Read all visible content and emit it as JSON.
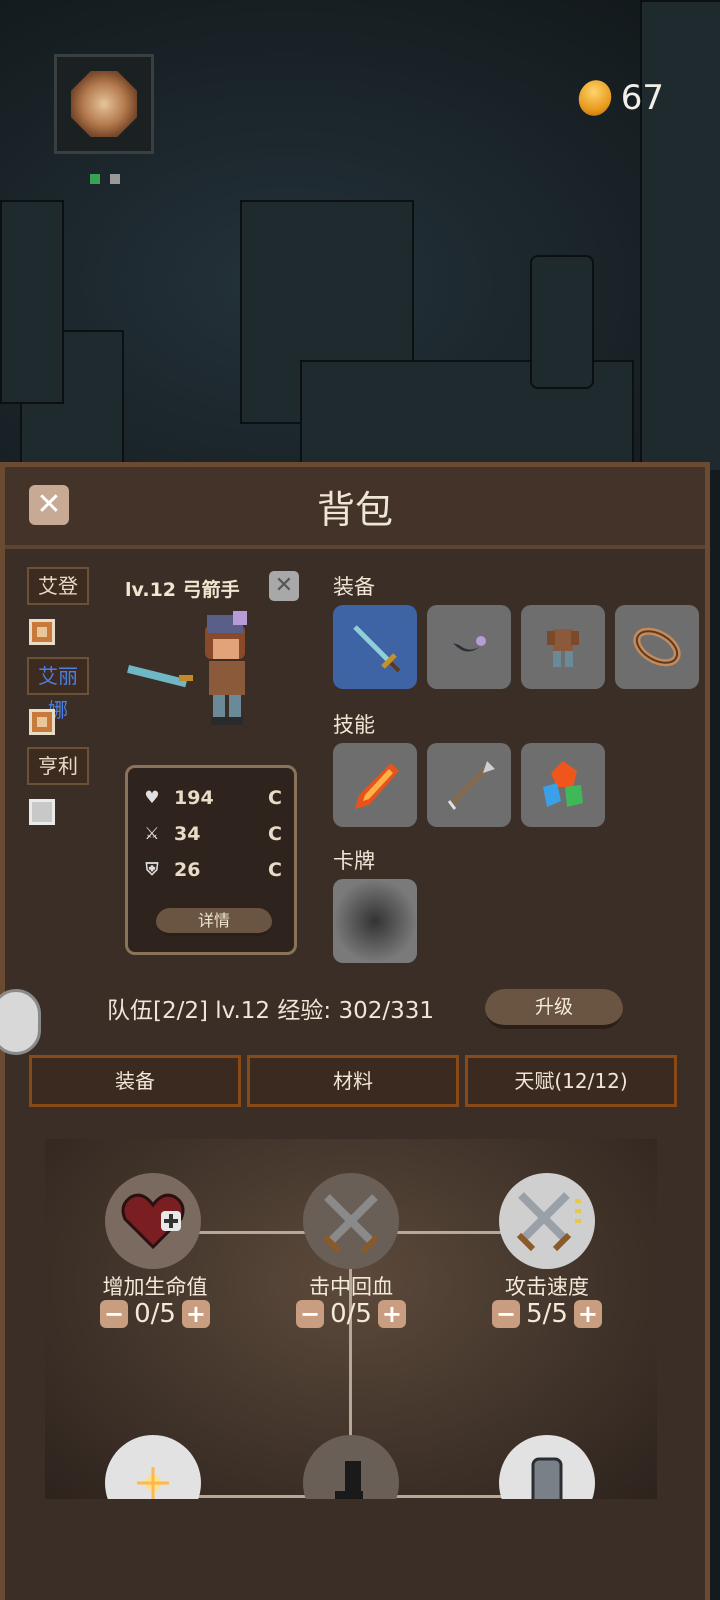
{
  "hud": {
    "coins": "67",
    "map_dots": [
      "#39a351",
      "#9a9a9a"
    ]
  },
  "panel": {
    "title": "背包",
    "close_icon": "close-icon"
  },
  "characters": [
    {
      "name": "艾登",
      "name_color": "#f0e6d0",
      "checkbox": "filled"
    },
    {
      "name": "艾丽娜",
      "name_color": "#4a7fe6",
      "checkbox": "filled"
    },
    {
      "name": "亨利",
      "name_color": "#f0e6d0",
      "checkbox": "empty"
    }
  ],
  "hero": {
    "title": "lv.12 弓箭手",
    "stats": [
      {
        "icon": "heart-icon",
        "value": "194",
        "grade": "C"
      },
      {
        "icon": "sword-icon",
        "value": "34",
        "grade": "C"
      },
      {
        "icon": "shield-icon",
        "value": "26",
        "grade": "C"
      }
    ],
    "detail_label": "详情"
  },
  "sections": {
    "equipment": "装备",
    "skills": "技能",
    "cards": "卡牌"
  },
  "equipment_slots": [
    "sword-icon",
    "cape-icon",
    "armor-icon",
    "bracelet-icon"
  ],
  "skill_slots": [
    "fire-arrow-icon",
    "arrow-icon",
    "gems-icon"
  ],
  "card_slots": [
    "empty-card-icon"
  ],
  "team": {
    "info": "队伍[2/2]  lv.12  经验: 302/331",
    "upgrade_label": "升级"
  },
  "tabs": [
    "装备",
    "材料",
    "天赋(12/12)"
  ],
  "talents": [
    {
      "icon": "heart-plus-icon",
      "label": "增加生命值",
      "value": "0/5"
    },
    {
      "icon": "crossed-swords-icon",
      "label": "击中回血",
      "value": "0/5"
    },
    {
      "icon": "swords-speed-icon",
      "label": "攻击速度",
      "value": "5/5"
    }
  ],
  "talents_row2": [
    "sparkle-icon",
    "boot-icon",
    "stone-icon"
  ]
}
